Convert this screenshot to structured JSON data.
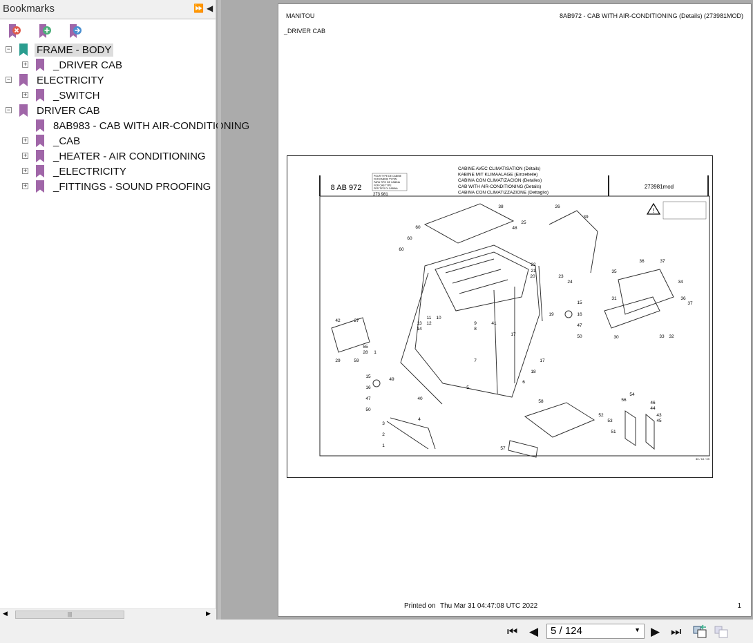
{
  "sidebar": {
    "title": "Bookmarks",
    "tools": [
      "delete-bookmark-icon",
      "add-bookmark-icon",
      "go-to-bookmark-icon"
    ],
    "items": [
      {
        "label": "FRAME - BODY",
        "level": 0,
        "expander": "minus",
        "color": "#2a9d8f",
        "selected": true
      },
      {
        "label": "_DRIVER CAB",
        "level": 1,
        "expander": "plus",
        "color": "#a066a8"
      },
      {
        "label": "ELECTRICITY",
        "level": 0,
        "expander": "minus",
        "color": "#a066a8"
      },
      {
        "label": "_SWITCH",
        "level": 1,
        "expander": "plus",
        "color": "#a066a8"
      },
      {
        "label": "DRIVER CAB",
        "level": 0,
        "expander": "minus",
        "color": "#a066a8"
      },
      {
        "label": "8AB983 - CAB WITH AIR-CONDITIONING",
        "level": 1,
        "expander": "none",
        "color": "#a066a8"
      },
      {
        "label": "_CAB",
        "level": 1,
        "expander": "plus",
        "color": "#a066a8"
      },
      {
        "label": "_HEATER - AIR CONDITIONING",
        "level": 1,
        "expander": "plus",
        "color": "#a066a8"
      },
      {
        "label": "_ELECTRICITY",
        "level": 1,
        "expander": "plus",
        "color": "#a066a8"
      },
      {
        "label": "_FITTINGS - SOUND PROOFING",
        "level": 1,
        "expander": "plus",
        "color": "#a066a8"
      }
    ]
  },
  "page": {
    "brand": "MANITOU",
    "header_right": "8AB972 - CAB WITH AIR-CONDITIONING (Details) (273981MOD)",
    "section": "_DRIVER CAB",
    "drawing": {
      "code": "8 AB 972",
      "ref_box": [
        "POUR TYPE DE CABINE",
        "FUR KABINE TYPEN",
        "PARA TIPO DE CABINA",
        "FOR CAB TYPE",
        "PER TIPO DI CABINA"
      ],
      "ref_number": "273 981",
      "titles": [
        "CABINE AVEC CLIMATISATION (Détails)",
        "KABINE MIT KLIMAALAGE (Einzelteile)",
        "CABINA CON CLIMATIZACION (Detalles)",
        "CAB WITH AIR-CONDITIONING (Details)",
        "CABINA  CON CLIMATIZZAZIONE (Dettaglio)"
      ],
      "doc_id": "273981mod",
      "callouts": [
        "38",
        "26",
        "39",
        "60",
        "60",
        "60",
        "48",
        "25",
        "22",
        "21",
        "20",
        "23",
        "24",
        "15",
        "16",
        "47",
        "50",
        "19",
        "35",
        "36",
        "37",
        "34",
        "31",
        "36",
        "37",
        "30",
        "33",
        "32",
        "42",
        "27",
        "55",
        "28",
        "29",
        "59",
        "1",
        "11",
        "10",
        "13",
        "12",
        "14",
        "9",
        "8",
        "41",
        "17",
        "17",
        "7",
        "18",
        "6",
        "5",
        "15",
        "16",
        "47",
        "50",
        "49",
        "40",
        "3",
        "4",
        "2",
        "1",
        "58",
        "57",
        "52",
        "54",
        "56",
        "46",
        "44",
        "43",
        "45",
        "53",
        "51"
      ],
      "date": "30 / 10 / 09"
    },
    "printed_label": "Printed on",
    "printed_date": "Thu Mar 31 04:47:08 UTC 2022",
    "page_number": "1"
  },
  "toolbar": {
    "page_value": "5 / 124"
  }
}
